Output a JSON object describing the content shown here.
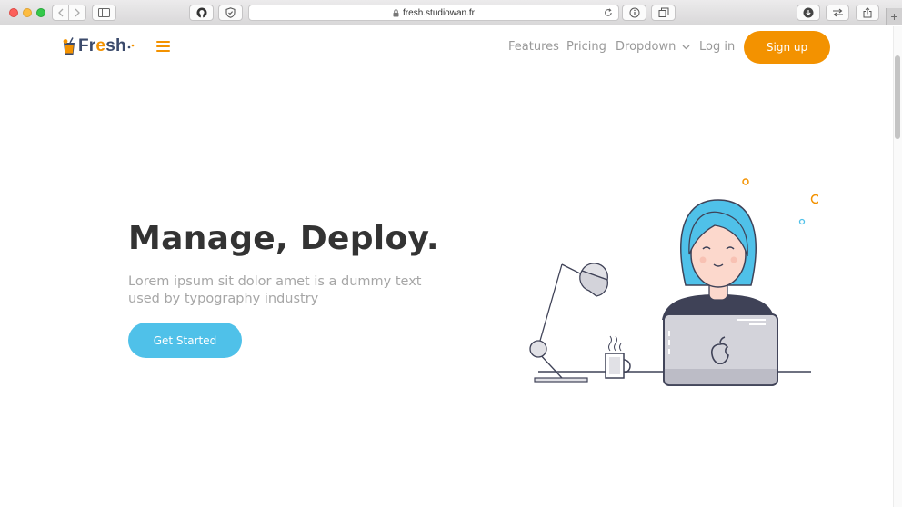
{
  "browser": {
    "url": "fresh.studiowan.fr",
    "new_tab": "+"
  },
  "nav": {
    "logo": "Fresh",
    "features": "Features",
    "pricing": "Pricing",
    "dropdown": "Dropdown",
    "login": "Log in",
    "signup": "Sign up"
  },
  "hero": {
    "title": "Manage, Deploy.",
    "subtitle": "Lorem ipsum sit dolor amet is a dummy text used by typography industry",
    "cta": "Get Started"
  },
  "colors": {
    "accent": "#f39200",
    "primary": "#4fc1e9",
    "dark": "#3b4a6b"
  },
  "icons": [
    "github-icon",
    "shield-icon",
    "lock-icon",
    "reload-icon",
    "info-icon",
    "tabs-icon",
    "download-icon",
    "share-icon",
    "sidebar-icon",
    "hamburger-icon",
    "chevron-down-icon"
  ]
}
